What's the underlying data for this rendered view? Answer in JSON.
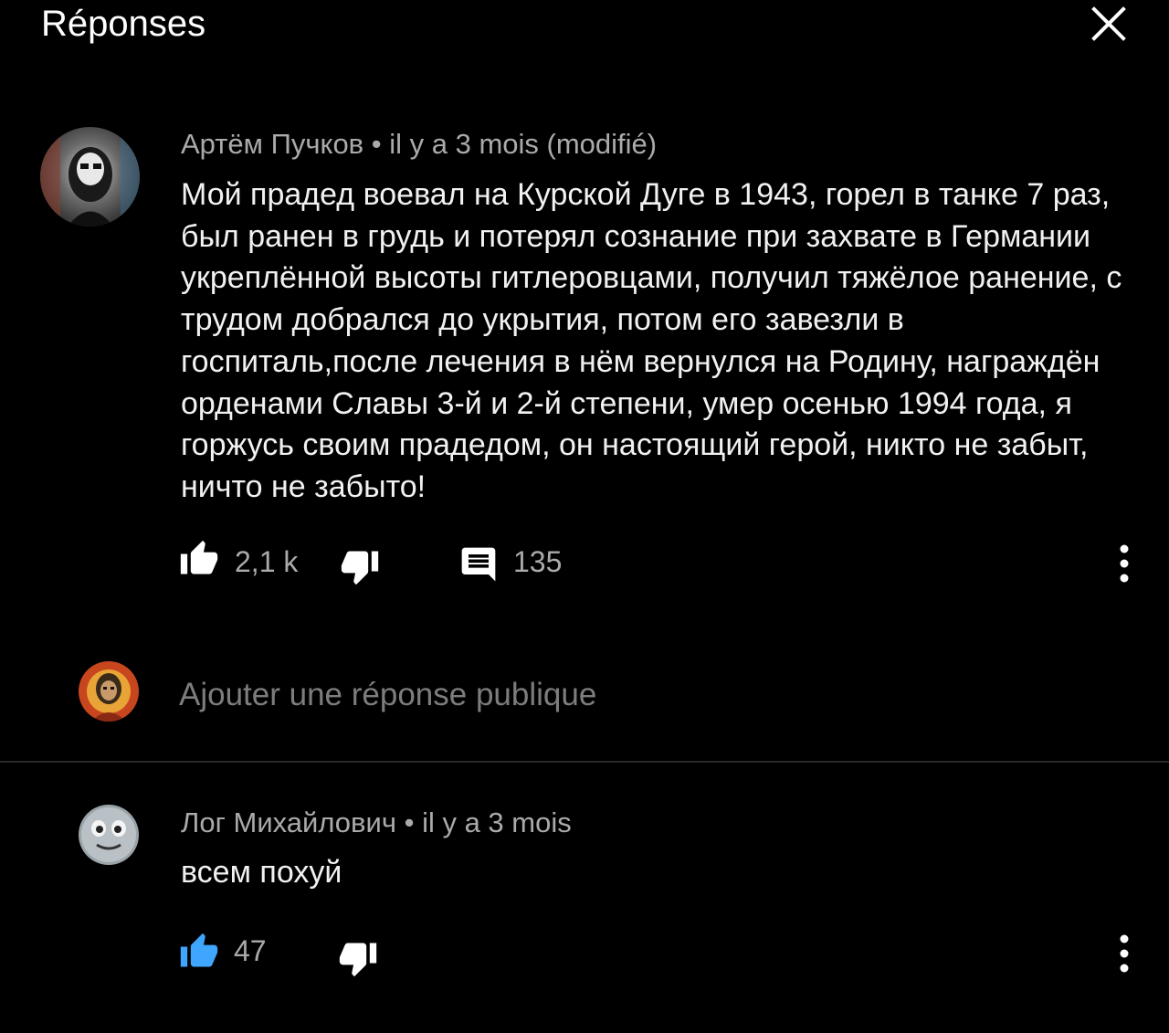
{
  "header": {
    "title": "Réponses",
    "close_icon": "close-icon"
  },
  "parent_comment": {
    "author": "Артём Пучков",
    "separator": "•",
    "time": "il y a 3 mois (modifié)",
    "text": "Мой прадед воевал на Курской Дуге в 1943, горел в танке 7 раз, был ранен в грудь и потерял сознание при захвате в Германии укреплённой высоты гитлеровцами, получил тяжёлое ранение, с трудом добрался до укрытия, потом его завезли в госпиталь,после лечения в нём вернулся на Родину, награждён орденами Славы 3-й и 2-й степени, умер осенью 1994 года, я горжусь своим прадедом, он настоящий герой, никто не забыт, ничто не забыто!",
    "likes": "2,1 k",
    "replies": "135",
    "icons": {
      "like": "thumbs-up-icon",
      "dislike": "thumbs-down-icon",
      "reply": "comment-icon",
      "more": "more-vert-icon"
    }
  },
  "reply_box": {
    "placeholder": "Ajouter une réponse publique"
  },
  "reply": {
    "author": "Лог Михайлович",
    "separator": "•",
    "time": "il y a 3 mois",
    "text": "всем похуй",
    "likes": "47",
    "like_active": true,
    "icons": {
      "like": "thumbs-up-icon",
      "dislike": "thumbs-down-icon",
      "more": "more-vert-icon"
    }
  },
  "colors": {
    "background": "#000000",
    "text_primary": "#f1f1f1",
    "text_secondary": "#aaaaaa",
    "placeholder": "#7d7d7d",
    "like_active": "#3ea6ff",
    "divider": "#2a2a2a"
  }
}
